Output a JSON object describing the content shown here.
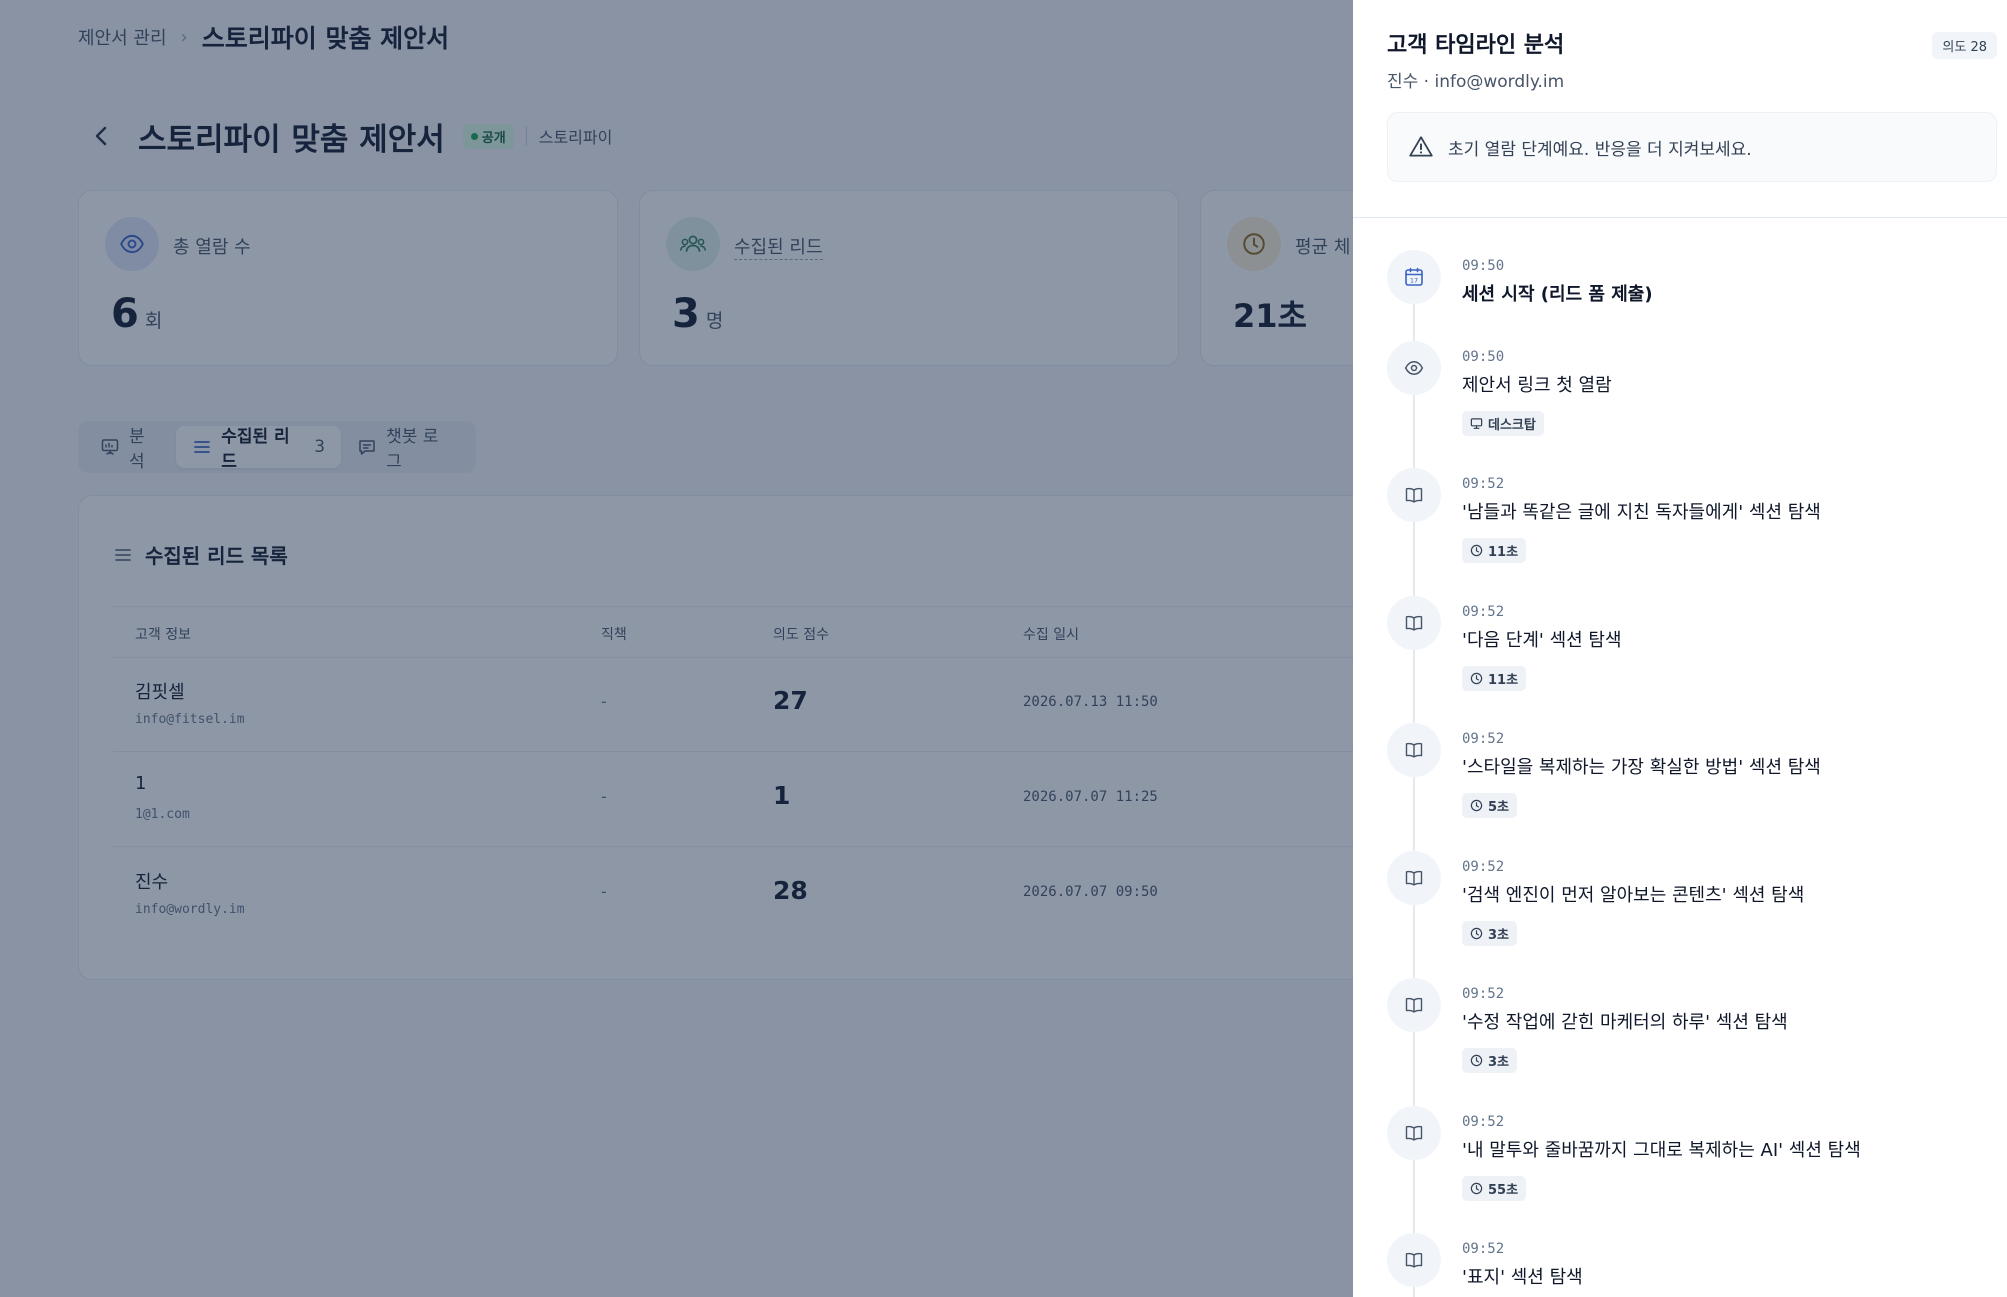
{
  "breadcrumb": {
    "root": "제안서 관리",
    "separator": "›",
    "current": "스토리파이 맞춤 제안서"
  },
  "header": {
    "title": "스토리파이 맞춤 제안서",
    "status_badge": "공개",
    "brand": "스토리파이"
  },
  "stats": [
    {
      "label": "총 열람 수",
      "value": "6",
      "unit": "회",
      "icon": "eye-icon"
    },
    {
      "label": "수집된 리드",
      "value": "3",
      "unit": "명",
      "icon": "users-icon"
    },
    {
      "label": "평균 체",
      "value": "21초",
      "unit": "",
      "icon": "clock-icon"
    }
  ],
  "tabs": [
    {
      "label": "분석",
      "icon": "presentation-chart-icon"
    },
    {
      "label": "수집된 리드",
      "count": "3",
      "icon": "list-icon"
    },
    {
      "label": "챗봇 로그",
      "icon": "chat-icon"
    }
  ],
  "leads_table": {
    "title": "수집된 리드 목록",
    "columns": [
      "고객 정보",
      "직책",
      "의도 점수",
      "수집 일시"
    ],
    "rows": [
      {
        "name": "김핏셀",
        "email": "info@fitsel.im",
        "position": "-",
        "score": "27",
        "date": "2026.07.13 11:50"
      },
      {
        "name": "1",
        "email": "1@1.com",
        "position": "-",
        "score": "1",
        "date": "2026.07.07 11:25"
      },
      {
        "name": "진수",
        "email": "info@wordly.im",
        "position": "-",
        "score": "28",
        "date": "2026.07.07 09:50"
      }
    ]
  },
  "drawer": {
    "title": "고객 타임라인 분석",
    "subtitle": "진수 · info@wordly.im",
    "intent_badge": "의도 28",
    "alert": "초기 열람 단계예요. 반응을 더 지켜보세요.",
    "events": [
      {
        "time": "09:50",
        "title": "세션 시작 (리드 폼 제출)",
        "icon": "calendar-icon",
        "chip": ""
      },
      {
        "time": "09:50",
        "title": "제안서 링크 첫 열람",
        "icon": "eye-icon",
        "chip": "데스크탑",
        "chip_icon": "monitor-icon"
      },
      {
        "time": "09:52",
        "title": "'남들과 똑같은 글에 지친 독자들에게' 섹션 탐색",
        "icon": "book-icon",
        "chip": "11초",
        "chip_icon": "clock-icon"
      },
      {
        "time": "09:52",
        "title": "'다음 단계' 섹션 탐색",
        "icon": "book-icon",
        "chip": "11초",
        "chip_icon": "clock-icon"
      },
      {
        "time": "09:52",
        "title": "'스타일을 복제하는 가장 확실한 방법' 섹션 탐색",
        "icon": "book-icon",
        "chip": "5초",
        "chip_icon": "clock-icon"
      },
      {
        "time": "09:52",
        "title": "'검색 엔진이 먼저 알아보는 콘텐츠' 섹션 탐색",
        "icon": "book-icon",
        "chip": "3초",
        "chip_icon": "clock-icon"
      },
      {
        "time": "09:52",
        "title": "'수정 작업에 갇힌 마케터의 하루' 섹션 탐색",
        "icon": "book-icon",
        "chip": "3초",
        "chip_icon": "clock-icon"
      },
      {
        "time": "09:52",
        "title": "'내 말투와 줄바꿈까지 그대로 복제하는 AI' 섹션 탐색",
        "icon": "book-icon",
        "chip": "55초",
        "chip_icon": "clock-icon"
      },
      {
        "time": "09:52",
        "title": "'표지' 섹션 탐색",
        "icon": "book-icon",
        "chip": ""
      }
    ]
  },
  "colors": {
    "overlay": "#1e304e",
    "accent": "#3b63c4",
    "public_green": "#16a34a"
  }
}
